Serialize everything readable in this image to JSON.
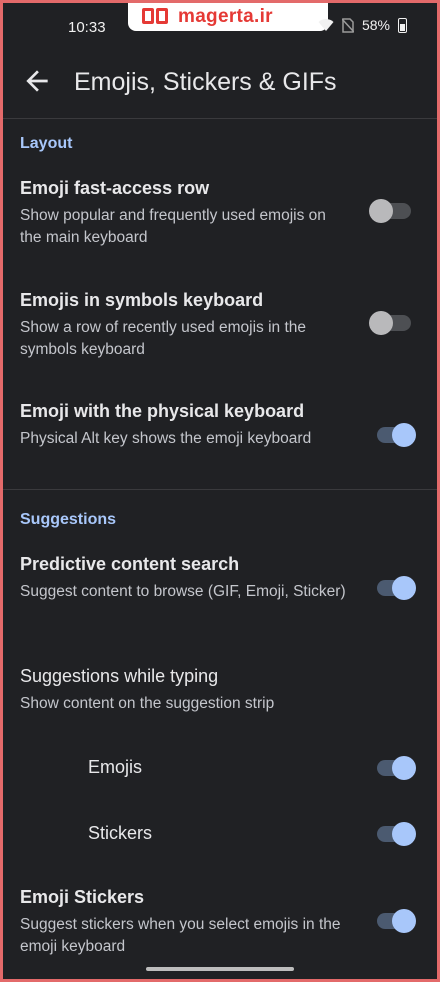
{
  "status_bar": {
    "time": "10:33",
    "watermark": "magerta.ir",
    "battery": "58%",
    "icons": [
      "wifi-icon",
      "no-sim-icon",
      "battery-icon"
    ]
  },
  "app_bar": {
    "title": "Emojis, Stickers & GIFs",
    "back_icon": "arrow-back-icon"
  },
  "sections": {
    "layout": {
      "header": "Layout",
      "items": [
        {
          "title": "Emoji fast-access row",
          "subtitle": "Show popular and frequently used emojis on the main keyboard",
          "enabled": false
        },
        {
          "title": "Emojis in symbols keyboard",
          "subtitle": "Show a row of recently used emojis in the symbols keyboard",
          "enabled": false
        },
        {
          "title": "Emoji with the physical keyboard",
          "subtitle": "Physical Alt key shows the emoji keyboard",
          "enabled": true
        }
      ]
    },
    "suggestions": {
      "header": "Suggestions",
      "predictive": {
        "title": "Predictive content search",
        "subtitle": "Suggest content to browse (GIF, Emoji, Sticker)",
        "enabled": true
      },
      "while_typing": {
        "title": "Suggestions while typing",
        "subtitle": "Show content on the suggestion strip",
        "children": [
          {
            "label": "Emojis",
            "enabled": true
          },
          {
            "label": "Stickers",
            "enabled": true
          }
        ]
      },
      "emoji_stickers": {
        "title": "Emoji Stickers",
        "subtitle": "Suggest stickers when you select emojis in the emoji keyboard",
        "enabled": true
      }
    }
  },
  "colors": {
    "background": "#202124",
    "accent": "#a8c7fa",
    "frame_border": "#e36a6a"
  }
}
